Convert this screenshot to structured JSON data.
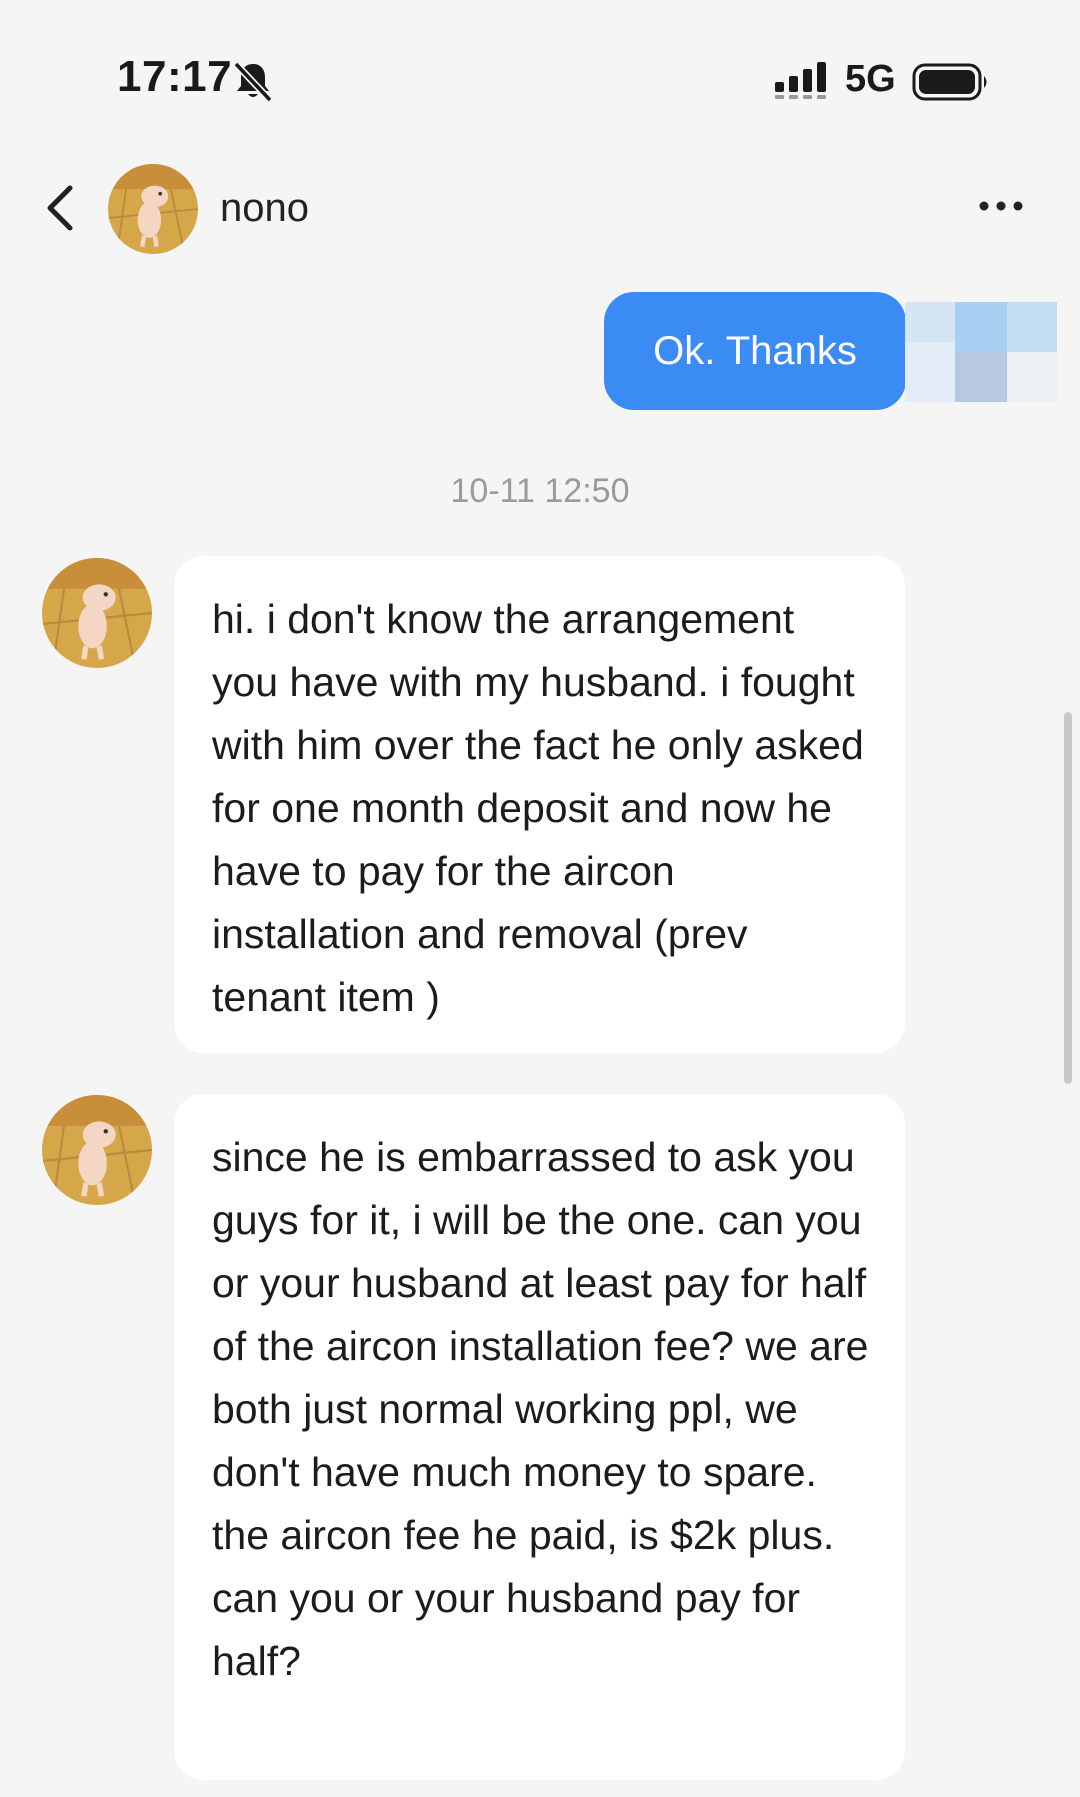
{
  "status_bar": {
    "time": "17:17",
    "network": "5G",
    "bell_icon": "bell-slash-icon",
    "signal_icon": "signal-icon",
    "battery_icon": "battery-icon"
  },
  "header": {
    "contact_name": "nono",
    "back_icon": "chevron-left-icon",
    "more_icon": "more-horizontal-icon"
  },
  "messages": {
    "outgoing_1": "Ok. Thanks",
    "timestamp": "10-11 12:50",
    "incoming_1": "hi. i don't know the arrangement you have with my husband. i fought with him over the fact he only asked for one month deposit and now he have to pay for the aircon installation and removal (prev tenant item )",
    "incoming_2": "since he is embarrassed to ask you guys for it, i will be the one. can you or your husband at least pay for half of the aircon installation fee? we are both just normal working ppl, we don't have much money to spare. the aircon fee he paid, is $2k plus. can you or your husband pay for half?"
  },
  "colors": {
    "outgoing_bubble": "#3b8bf5",
    "incoming_bubble": "#ffffff",
    "background": "#f5f5f5",
    "timestamp": "#9a9a9a"
  }
}
